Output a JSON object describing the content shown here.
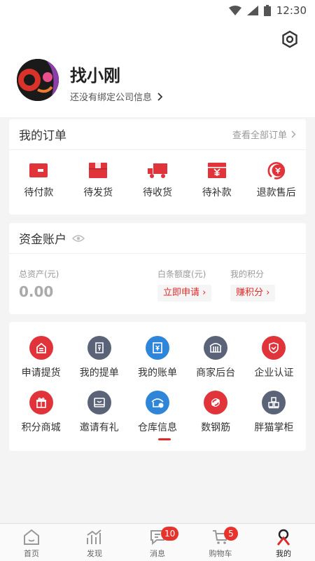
{
  "status_bar": {
    "time": "12:30"
  },
  "profile": {
    "name": "找小刚",
    "company_hint": "还没有绑定公司信息"
  },
  "orders": {
    "title": "我的订单",
    "view_all": "查看全部订单",
    "items": [
      {
        "label": "待付款",
        "icon": "wallet-icon"
      },
      {
        "label": "待发货",
        "icon": "box-icon"
      },
      {
        "label": "待收货",
        "icon": "truck-icon"
      },
      {
        "label": "待补款",
        "icon": "yuan-box-icon"
      },
      {
        "label": "退款售后",
        "icon": "refund-icon"
      }
    ]
  },
  "assets": {
    "title": "资金账户",
    "total_label": "总资产(元)",
    "total_value": "0.00",
    "credit_label": "白条额度(元)",
    "credit_button": "立即申请",
    "points_label": "我的积分",
    "points_button": "赚积分"
  },
  "tools": {
    "row1": [
      {
        "label": "申请提货",
        "icon": "pickup-icon",
        "color": "#e0333a"
      },
      {
        "label": "我的提单",
        "icon": "bill-icon",
        "color": "#5a6378"
      },
      {
        "label": "我的账单",
        "icon": "ledger-icon",
        "color": "#2f86d8"
      },
      {
        "label": "商家后台",
        "icon": "store-icon",
        "color": "#5a6378"
      },
      {
        "label": "企业认证",
        "icon": "shield-check-icon",
        "color": "#e0333a"
      }
    ],
    "row2": [
      {
        "label": "积分商城",
        "icon": "gift-icon",
        "color": "#e0333a"
      },
      {
        "label": "邀请有礼",
        "icon": "invite-icon",
        "color": "#5a6378"
      },
      {
        "label": "仓库信息",
        "icon": "warehouse-icon",
        "color": "#2f86d8"
      },
      {
        "label": "数钢筋",
        "icon": "rebar-icon",
        "color": "#e0333a"
      },
      {
        "label": "胖猫掌柜",
        "icon": "boxes-icon",
        "color": "#5a6378"
      }
    ]
  },
  "tabbar": {
    "items": [
      {
        "label": "首页"
      },
      {
        "label": "发现"
      },
      {
        "label": "消息",
        "badge": "10"
      },
      {
        "label": "购物车",
        "badge": "5"
      },
      {
        "label": "我的"
      }
    ]
  },
  "colors": {
    "accent": "#e02a2a",
    "blue": "#2f86d8",
    "slate": "#5a6378"
  }
}
